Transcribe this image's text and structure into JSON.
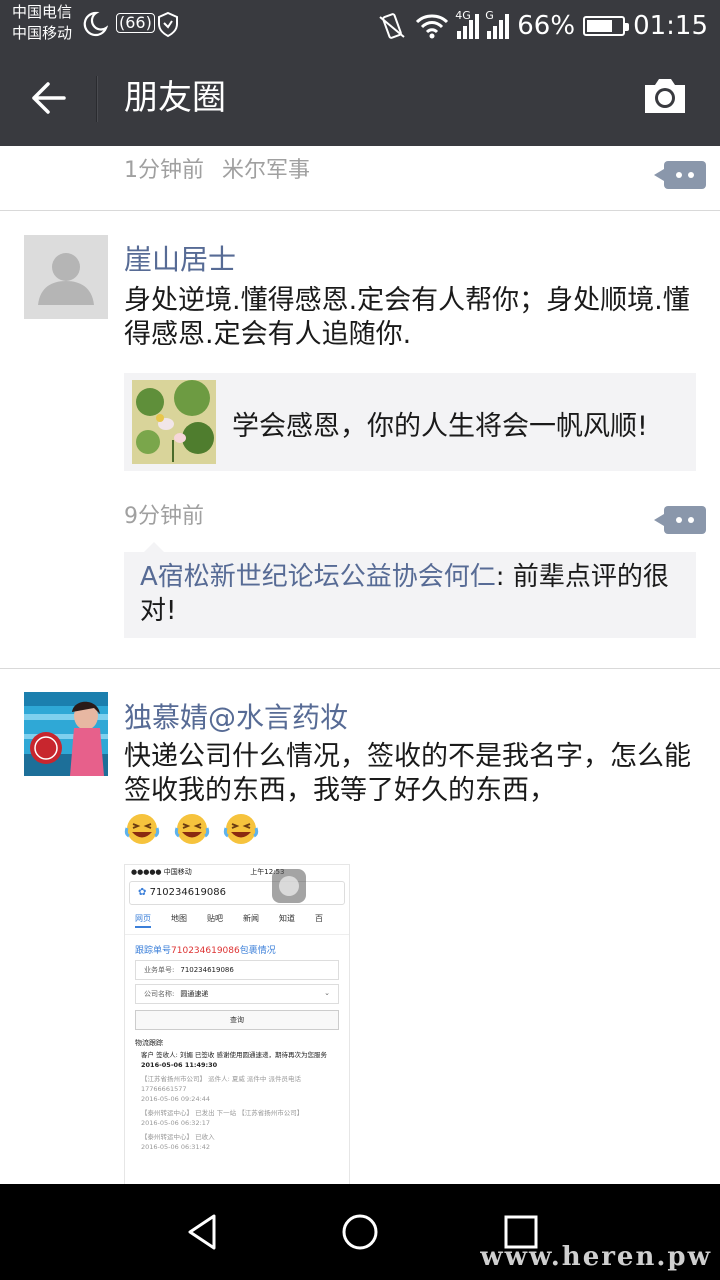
{
  "status_bar": {
    "carrier1": "中国电信",
    "carrier2": "中国移动",
    "hd_label": "(66)",
    "net1": "4G",
    "net2": "G",
    "battery": "66%",
    "battery_level": 0.66,
    "time": "01:15"
  },
  "nav": {
    "title": "朋友圈",
    "back_icon": "back-arrow-icon",
    "camera_icon": "camera-icon"
  },
  "feed": {
    "top_post": {
      "time": "1分钟前",
      "source": "米尔军事"
    },
    "post1": {
      "name": "崖山居士",
      "text": "身处逆境.懂得感恩.定会有人帮你；身处顺境.懂得感恩.定会有人追随你.",
      "share_title": "学会感恩，你的人生将会一帆风顺!",
      "time": "9分钟前",
      "comment_author": "A宿松新世纪论坛公益协会何仁",
      "comment_text": ": 前辈点评的很对!"
    },
    "post2": {
      "name": "独慕婧@水言药妆",
      "text": "快递公司什么情况，签收的不是我名字，怎么能签收我的东西，我等了好久的东西，",
      "emoji_count": 3,
      "screenshot": {
        "status_left": "●●●●● 中国移动 ",
        "status_time": "上午12:53",
        "address": "710234619086",
        "tabs": [
          "网页",
          "地图",
          "贴吧",
          "新闻",
          "知道",
          "百"
        ],
        "heading_prefix": "跟踪单号",
        "heading_number": "710234619086",
        "heading_suffix": "包裹情况",
        "field1_label": "业务单号:",
        "field1_value": "710234619086",
        "field2_label": "公司名称:",
        "field2_value": "圆通速递",
        "query_button": "查询",
        "tracking_label": "物流跟踪",
        "record1": "客户 签收人: 刘媚 已签收 感谢使用圆通速递，期待再次为您服务",
        "record1_time": "2016-05-06 11:49:30",
        "record2": "【江苏省扬州市公司】 派件人: 夏威 派件中 派件员电话17766661577",
        "record2_time": "2016-05-06 09:24:44",
        "record3": "【泰州转运中心】 已发出 下一站 【江苏省扬州市公司】",
        "record3_time": "2016-05-06 06:32:17",
        "record4": "【泰州转运中心】 已收入",
        "record4_time": "2016-05-06 06:31:42"
      }
    }
  },
  "watermark": "www.heren.pw",
  "colors": {
    "bar": "#393a3f",
    "link": "#576b95",
    "comment_bg": "#f3f3f5"
  }
}
